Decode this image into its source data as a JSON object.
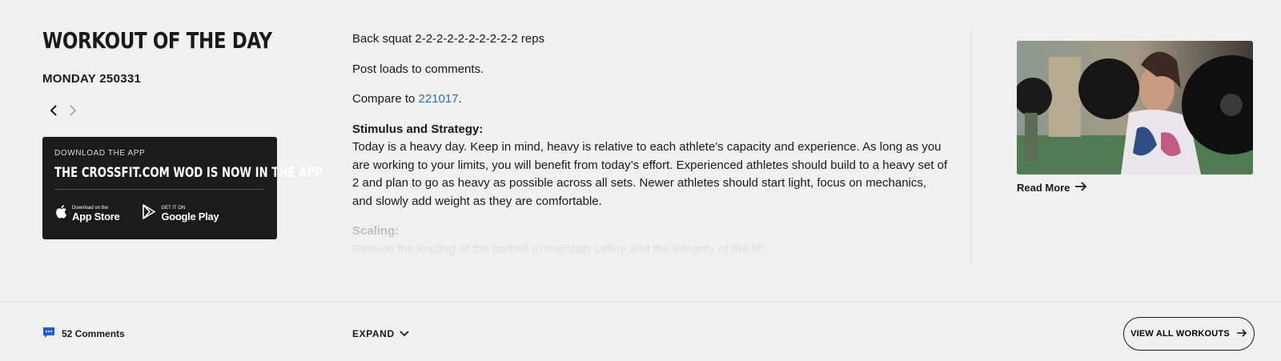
{
  "wod": {
    "title": "WORKOUT OF THE DAY",
    "date": "MONDAY 250331"
  },
  "nav": {
    "prev_icon": "chevron-left-icon",
    "next_icon": "chevron-right-icon"
  },
  "app_promo": {
    "kicker": "DOWNLOAD THE APP",
    "headline": "THE CROSSFIT.COM WOD IS NOW IN THE APP",
    "app_store": {
      "small": "Download on the",
      "big": "App Store"
    },
    "google_play": {
      "small": "GET IT ON",
      "big": "Google Play"
    }
  },
  "workout": {
    "line1": "Back squat 2-2-2-2-2-2-2-2-2-2 reps",
    "line2": "Post loads to comments.",
    "compare_prefix": "Compare to ",
    "compare_link": "221017",
    "compare_suffix": ".",
    "stimulus_heading": "Stimulus and Strategy:",
    "stimulus_text": "Today is a heavy day. Keep in mind, heavy is relative to each athlete's capacity and experience. As long as you are working to your limits, you will benefit from today’s effort. Experienced athletes should build to a heavy set of 2 and plan to go as heavy as possible across all sets. Newer athletes should start light, focus on mechanics, and slowly add weight as they are comfortable.",
    "scaling_heading": "Scaling:",
    "scaling_text": "Reduce the loading of the barbell to maintain safety and the integrity of the lift."
  },
  "feature": {
    "read_more": "Read More"
  },
  "footer": {
    "comments": "52 Comments",
    "expand": "EXPAND",
    "view_all": "VIEW ALL WORKOUTS"
  },
  "colors": {
    "link": "#2a6cc6",
    "comment_icon": "#1f5fd0",
    "card_bg": "#1b1b1b"
  }
}
